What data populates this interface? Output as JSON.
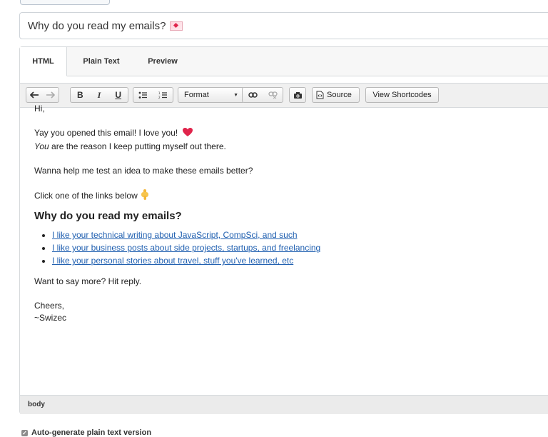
{
  "subject": {
    "value": "Why do you read my emails?",
    "emoji_icon": "love-letter-icon"
  },
  "tabs": [
    {
      "label": "HTML",
      "active": true
    },
    {
      "label": "Plain Text",
      "active": false
    },
    {
      "label": "Preview",
      "active": false
    }
  ],
  "toolbar": {
    "undo_icon": "undo-icon",
    "redo_icon": "redo-icon",
    "bold": "B",
    "italic": "I",
    "underline": "U",
    "bullet_list_icon": "bullet-list-icon",
    "numbered_list_icon": "numbered-list-icon",
    "format_select": "Format",
    "link_icon": "link-icon",
    "unlink_icon": "unlink-icon",
    "image_icon": "camera-icon",
    "source_label": "Source",
    "shortcodes_label": "View Shortcodes"
  },
  "body": {
    "greeting": "Hi,",
    "line1": "Yay you opened this email! I love you!",
    "line2_italic": "You",
    "line2_rest": " are the reason I keep putting myself out there.",
    "line3": "Wanna help me test an idea to make these emails better?",
    "line4": "Click one of the links below",
    "heading": "Why do you read my emails?",
    "links": [
      "I like your technical writing about JavaScript, CompSci, and such",
      "I like your business posts about side projects, startups, and freelancing",
      "I like your personal stories about travel, stuff you've learned, etc"
    ],
    "line5": "Want to say more? Hit reply.",
    "signoff1": "Cheers,",
    "signoff2": "~Swizec"
  },
  "statusbar": {
    "path": "body"
  },
  "options": {
    "auto_generate_label": "Auto-generate plain text version",
    "auto_generate_checked": true
  },
  "colors": {
    "link": "#1f5fb0",
    "heart": "#e0244b"
  }
}
